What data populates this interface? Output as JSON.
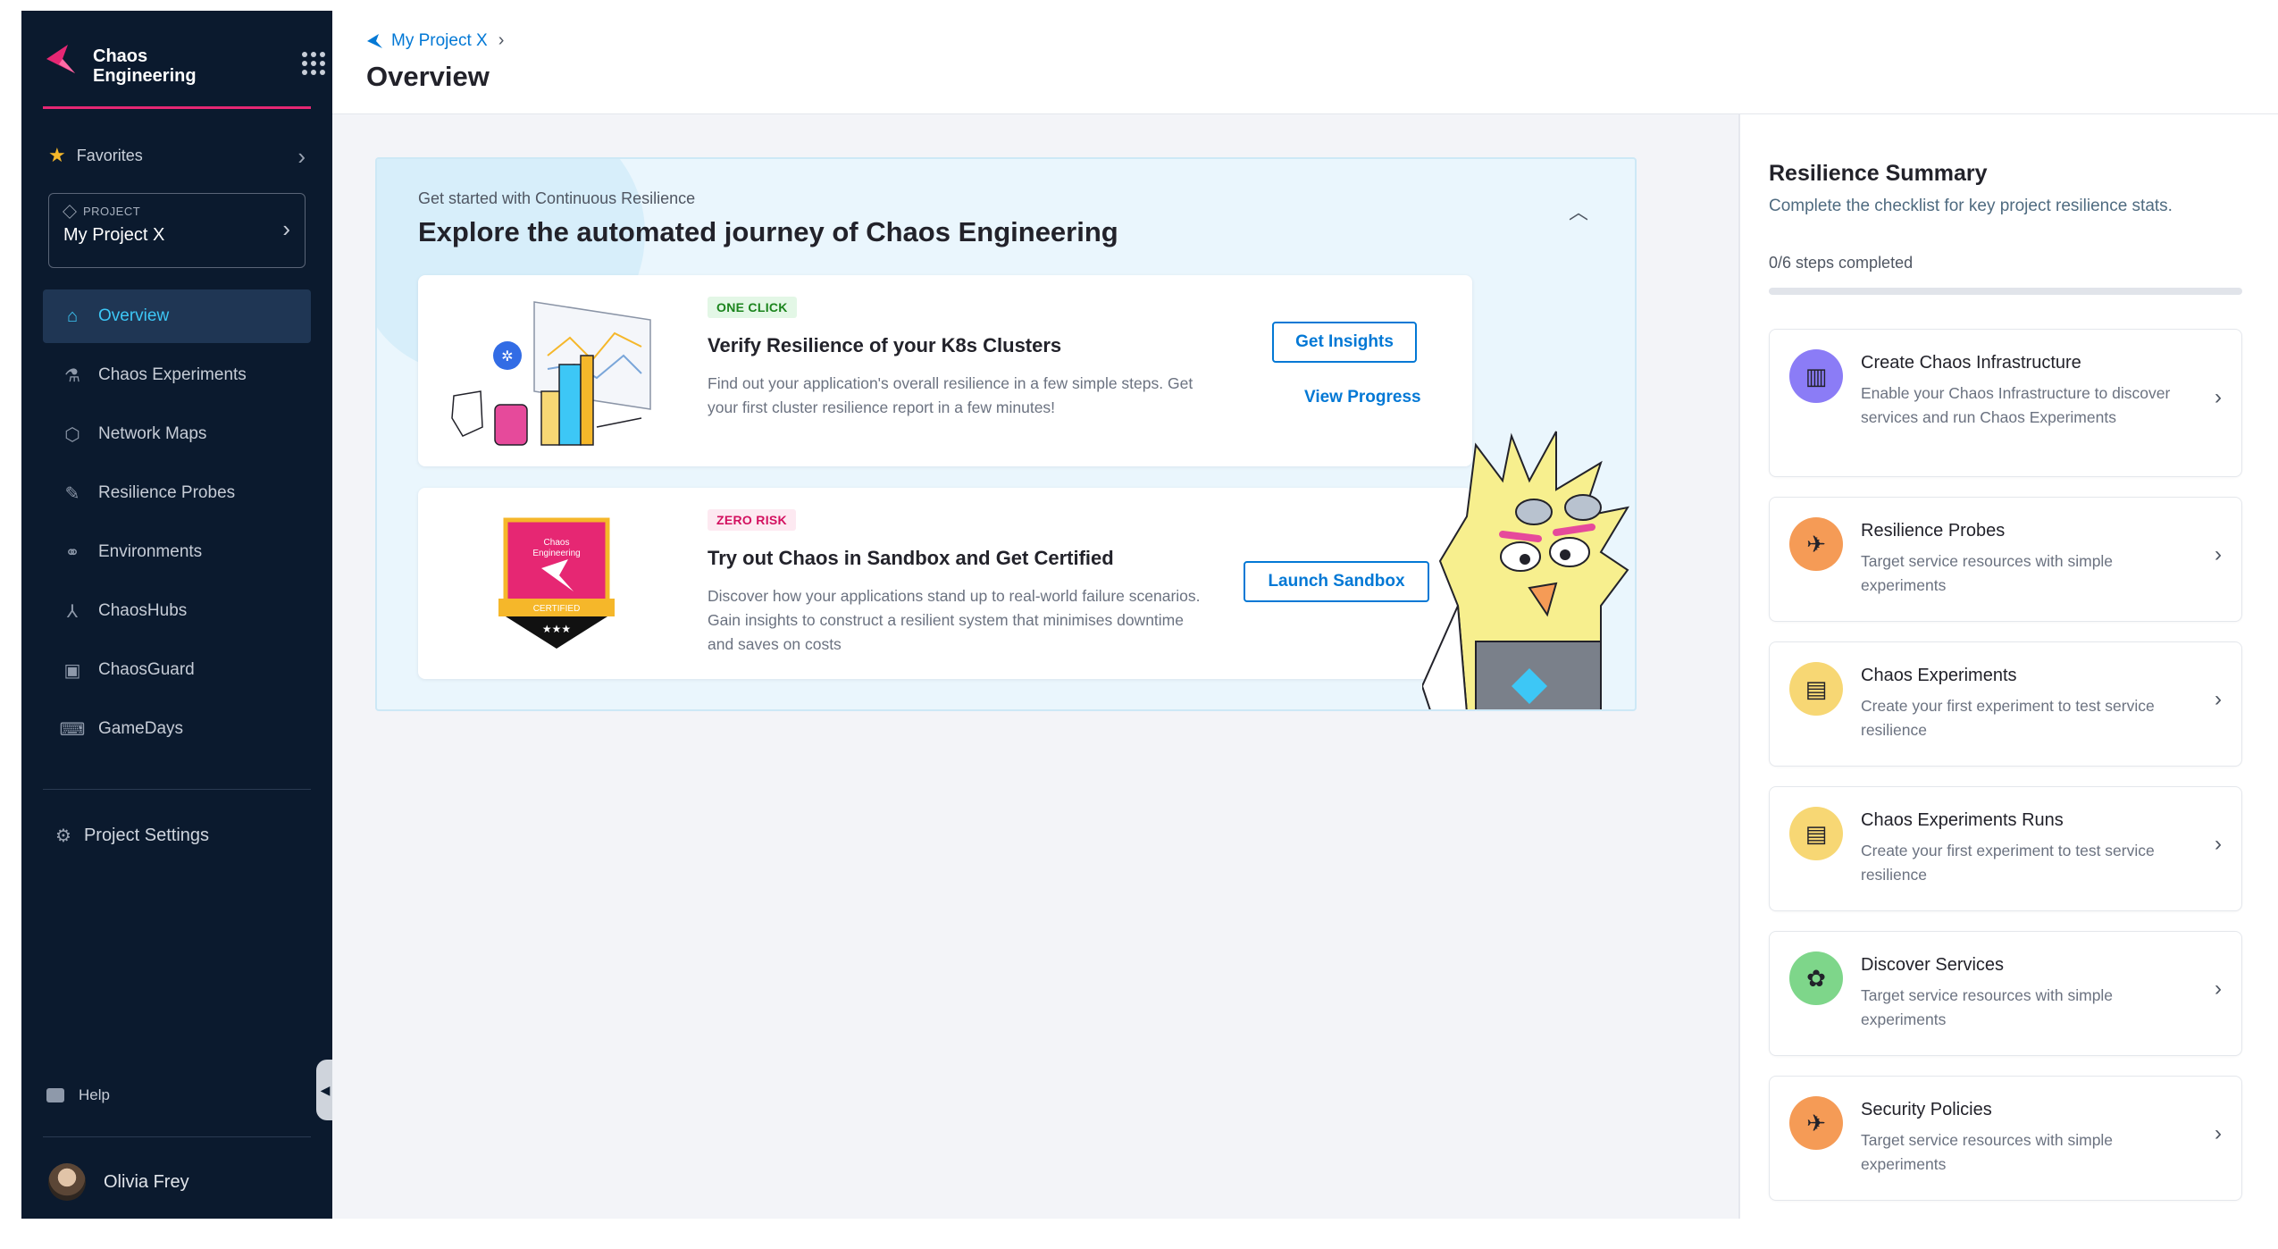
{
  "app": {
    "name": "Chaos Engineering"
  },
  "sidebar": {
    "favorites_label": "Favorites",
    "project_label": "PROJECT",
    "project_name": "My Project X",
    "items": [
      {
        "label": "Overview",
        "icon": "home-icon",
        "active": true
      },
      {
        "label": "Chaos Experiments",
        "icon": "flask-icon",
        "active": false
      },
      {
        "label": "Network Maps",
        "icon": "hexagon-icon",
        "active": false
      },
      {
        "label": "Resilience Probes",
        "icon": "probe-icon",
        "active": false
      },
      {
        "label": "Environments",
        "icon": "environments-icon",
        "active": false
      },
      {
        "label": "ChaosHubs",
        "icon": "hub-icon",
        "active": false
      },
      {
        "label": "ChaosGuard",
        "icon": "lock-icon",
        "active": false
      },
      {
        "label": "GameDays",
        "icon": "gamepad-icon",
        "active": false
      }
    ],
    "project_settings_label": "Project Settings",
    "help_label": "Help",
    "user_name": "Olivia Frey"
  },
  "header": {
    "breadcrumb": "My Project X",
    "title": "Overview"
  },
  "banner": {
    "pretitle": "Get started with Continuous Resilience",
    "title": "Explore the automated journey of Chaos Engineering",
    "cards": [
      {
        "badge": "ONE CLICK",
        "title": "Verify Resilience of your K8s Clusters",
        "desc": "Find out your application's overall resilience in a few simple steps. Get your first cluster resilience report in a few minutes!",
        "primary_button": "Get Insights",
        "secondary_link": "View Progress"
      },
      {
        "badge": "ZERO RISK",
        "title": "Try out Chaos in Sandbox and Get Certified",
        "desc": "Discover how your applications stand up to real-world failure scenarios. Gain insights to construct a resilient system that minimises downtime and saves on costs",
        "primary_button": "Launch Sandbox",
        "badge_image_text": [
          "Chaos",
          "Engineering",
          "CERTIFIED"
        ]
      }
    ]
  },
  "summary": {
    "title": "Resilience Summary",
    "subtitle": "Complete the checklist for key project resilience stats.",
    "steps_text": "0/6 steps completed",
    "progress": 0,
    "tasks": [
      {
        "title": "Create Chaos Infrastructure",
        "desc": "Enable your Chaos Infrastructure to discover services and run Chaos Experiments",
        "icon": "infrastructure-icon",
        "color": "#8b7cf6"
      },
      {
        "title": "Resilience Probes",
        "desc": "Target service resources with simple experiments",
        "icon": "drone-icon",
        "color": "#f59b56"
      },
      {
        "title": "Chaos Experiments",
        "desc": "Create your first experiment to test service resilience",
        "icon": "clipboard-icon",
        "color": "#f7d774"
      },
      {
        "title": "Chaos Experiments Runs",
        "desc": "Create your first experiment to test service resilience",
        "icon": "clipboard-icon",
        "color": "#f7d774"
      },
      {
        "title": "Discover Services",
        "desc": "Target service resources with simple experiments",
        "icon": "discover-icon",
        "color": "#7ed68a"
      },
      {
        "title": "Security Policies",
        "desc": "Target service resources with simple experiments",
        "icon": "drone-icon",
        "color": "#f59b56"
      }
    ]
  }
}
